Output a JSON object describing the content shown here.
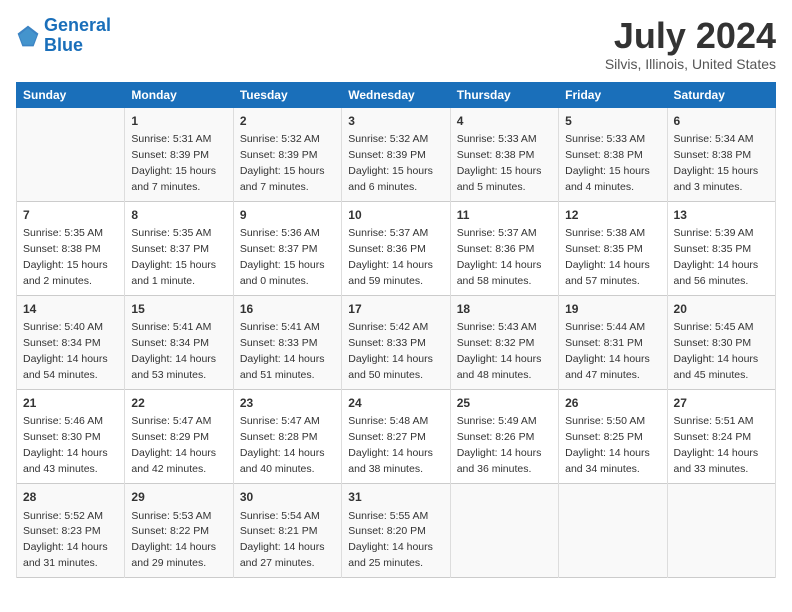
{
  "header": {
    "logo_line1": "General",
    "logo_line2": "Blue",
    "month": "July 2024",
    "location": "Silvis, Illinois, United States"
  },
  "weekdays": [
    "Sunday",
    "Monday",
    "Tuesday",
    "Wednesday",
    "Thursday",
    "Friday",
    "Saturday"
  ],
  "weeks": [
    [
      {
        "day": "",
        "sunrise": "",
        "sunset": "",
        "daylight": ""
      },
      {
        "day": "1",
        "sunrise": "Sunrise: 5:31 AM",
        "sunset": "Sunset: 8:39 PM",
        "daylight": "Daylight: 15 hours and 7 minutes."
      },
      {
        "day": "2",
        "sunrise": "Sunrise: 5:32 AM",
        "sunset": "Sunset: 8:39 PM",
        "daylight": "Daylight: 15 hours and 7 minutes."
      },
      {
        "day": "3",
        "sunrise": "Sunrise: 5:32 AM",
        "sunset": "Sunset: 8:39 PM",
        "daylight": "Daylight: 15 hours and 6 minutes."
      },
      {
        "day": "4",
        "sunrise": "Sunrise: 5:33 AM",
        "sunset": "Sunset: 8:38 PM",
        "daylight": "Daylight: 15 hours and 5 minutes."
      },
      {
        "day": "5",
        "sunrise": "Sunrise: 5:33 AM",
        "sunset": "Sunset: 8:38 PM",
        "daylight": "Daylight: 15 hours and 4 minutes."
      },
      {
        "day": "6",
        "sunrise": "Sunrise: 5:34 AM",
        "sunset": "Sunset: 8:38 PM",
        "daylight": "Daylight: 15 hours and 3 minutes."
      }
    ],
    [
      {
        "day": "7",
        "sunrise": "Sunrise: 5:35 AM",
        "sunset": "Sunset: 8:38 PM",
        "daylight": "Daylight: 15 hours and 2 minutes."
      },
      {
        "day": "8",
        "sunrise": "Sunrise: 5:35 AM",
        "sunset": "Sunset: 8:37 PM",
        "daylight": "Daylight: 15 hours and 1 minute."
      },
      {
        "day": "9",
        "sunrise": "Sunrise: 5:36 AM",
        "sunset": "Sunset: 8:37 PM",
        "daylight": "Daylight: 15 hours and 0 minutes."
      },
      {
        "day": "10",
        "sunrise": "Sunrise: 5:37 AM",
        "sunset": "Sunset: 8:36 PM",
        "daylight": "Daylight: 14 hours and 59 minutes."
      },
      {
        "day": "11",
        "sunrise": "Sunrise: 5:37 AM",
        "sunset": "Sunset: 8:36 PM",
        "daylight": "Daylight: 14 hours and 58 minutes."
      },
      {
        "day": "12",
        "sunrise": "Sunrise: 5:38 AM",
        "sunset": "Sunset: 8:35 PM",
        "daylight": "Daylight: 14 hours and 57 minutes."
      },
      {
        "day": "13",
        "sunrise": "Sunrise: 5:39 AM",
        "sunset": "Sunset: 8:35 PM",
        "daylight": "Daylight: 14 hours and 56 minutes."
      }
    ],
    [
      {
        "day": "14",
        "sunrise": "Sunrise: 5:40 AM",
        "sunset": "Sunset: 8:34 PM",
        "daylight": "Daylight: 14 hours and 54 minutes."
      },
      {
        "day": "15",
        "sunrise": "Sunrise: 5:41 AM",
        "sunset": "Sunset: 8:34 PM",
        "daylight": "Daylight: 14 hours and 53 minutes."
      },
      {
        "day": "16",
        "sunrise": "Sunrise: 5:41 AM",
        "sunset": "Sunset: 8:33 PM",
        "daylight": "Daylight: 14 hours and 51 minutes."
      },
      {
        "day": "17",
        "sunrise": "Sunrise: 5:42 AM",
        "sunset": "Sunset: 8:33 PM",
        "daylight": "Daylight: 14 hours and 50 minutes."
      },
      {
        "day": "18",
        "sunrise": "Sunrise: 5:43 AM",
        "sunset": "Sunset: 8:32 PM",
        "daylight": "Daylight: 14 hours and 48 minutes."
      },
      {
        "day": "19",
        "sunrise": "Sunrise: 5:44 AM",
        "sunset": "Sunset: 8:31 PM",
        "daylight": "Daylight: 14 hours and 47 minutes."
      },
      {
        "day": "20",
        "sunrise": "Sunrise: 5:45 AM",
        "sunset": "Sunset: 8:30 PM",
        "daylight": "Daylight: 14 hours and 45 minutes."
      }
    ],
    [
      {
        "day": "21",
        "sunrise": "Sunrise: 5:46 AM",
        "sunset": "Sunset: 8:30 PM",
        "daylight": "Daylight: 14 hours and 43 minutes."
      },
      {
        "day": "22",
        "sunrise": "Sunrise: 5:47 AM",
        "sunset": "Sunset: 8:29 PM",
        "daylight": "Daylight: 14 hours and 42 minutes."
      },
      {
        "day": "23",
        "sunrise": "Sunrise: 5:47 AM",
        "sunset": "Sunset: 8:28 PM",
        "daylight": "Daylight: 14 hours and 40 minutes."
      },
      {
        "day": "24",
        "sunrise": "Sunrise: 5:48 AM",
        "sunset": "Sunset: 8:27 PM",
        "daylight": "Daylight: 14 hours and 38 minutes."
      },
      {
        "day": "25",
        "sunrise": "Sunrise: 5:49 AM",
        "sunset": "Sunset: 8:26 PM",
        "daylight": "Daylight: 14 hours and 36 minutes."
      },
      {
        "day": "26",
        "sunrise": "Sunrise: 5:50 AM",
        "sunset": "Sunset: 8:25 PM",
        "daylight": "Daylight: 14 hours and 34 minutes."
      },
      {
        "day": "27",
        "sunrise": "Sunrise: 5:51 AM",
        "sunset": "Sunset: 8:24 PM",
        "daylight": "Daylight: 14 hours and 33 minutes."
      }
    ],
    [
      {
        "day": "28",
        "sunrise": "Sunrise: 5:52 AM",
        "sunset": "Sunset: 8:23 PM",
        "daylight": "Daylight: 14 hours and 31 minutes."
      },
      {
        "day": "29",
        "sunrise": "Sunrise: 5:53 AM",
        "sunset": "Sunset: 8:22 PM",
        "daylight": "Daylight: 14 hours and 29 minutes."
      },
      {
        "day": "30",
        "sunrise": "Sunrise: 5:54 AM",
        "sunset": "Sunset: 8:21 PM",
        "daylight": "Daylight: 14 hours and 27 minutes."
      },
      {
        "day": "31",
        "sunrise": "Sunrise: 5:55 AM",
        "sunset": "Sunset: 8:20 PM",
        "daylight": "Daylight: 14 hours and 25 minutes."
      },
      {
        "day": "",
        "sunrise": "",
        "sunset": "",
        "daylight": ""
      },
      {
        "day": "",
        "sunrise": "",
        "sunset": "",
        "daylight": ""
      },
      {
        "day": "",
        "sunrise": "",
        "sunset": "",
        "daylight": ""
      }
    ]
  ]
}
